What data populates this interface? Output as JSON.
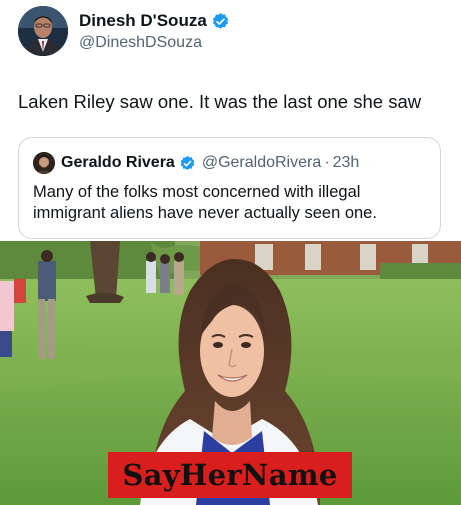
{
  "colors": {
    "verified_blue": "#1d9bf0",
    "text_primary": "#0f1419",
    "text_secondary": "#536471",
    "card_border": "#cfd9de",
    "banner_red": "#d91e1e"
  },
  "tweet": {
    "author": {
      "display_name": "Dinesh D'Souza",
      "handle": "@DineshDSouza",
      "avatar_icon": "profile-photo",
      "verified_icon": "verified-badge-icon"
    },
    "text": "Laken Riley saw one. It was the last one she saw"
  },
  "quoted_tweet": {
    "author": {
      "display_name": "Geraldo Rivera",
      "handle": "@GeraldoRivera",
      "separator": "·",
      "time": "23h"
    },
    "text": "Many of the folks most concerned with illegal immigrant aliens have never actually seen one."
  },
  "media": {
    "banner_text": "SayHerName"
  }
}
